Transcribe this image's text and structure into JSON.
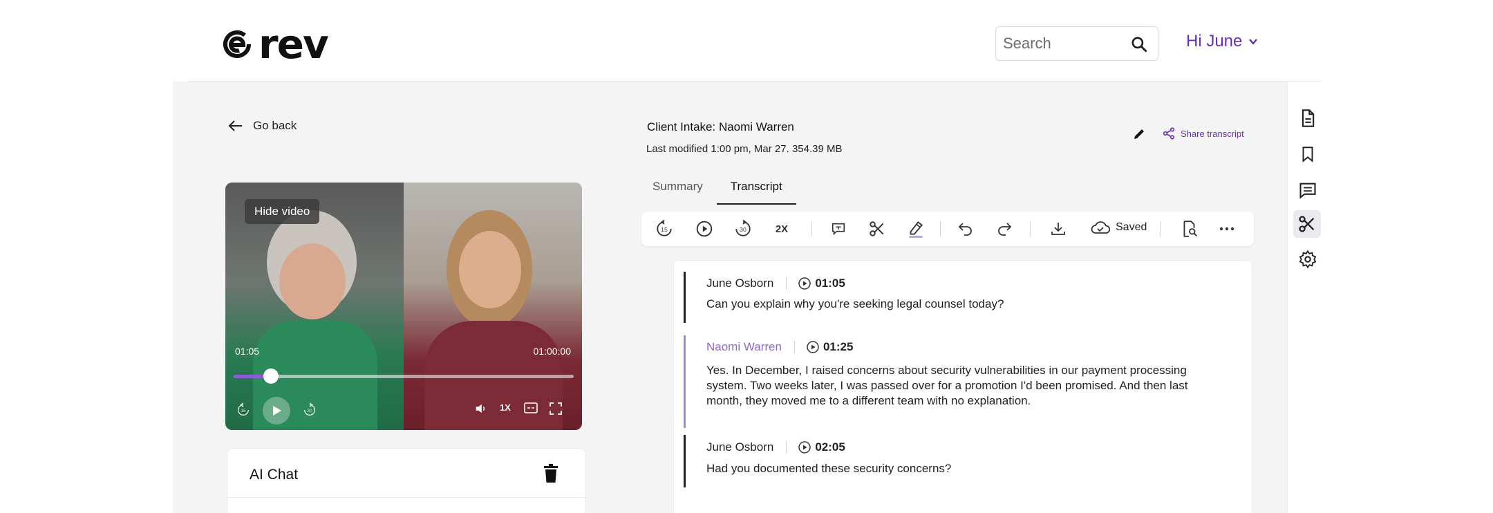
{
  "brand": {
    "logo_text": "rev",
    "accent": "#6a2fb5"
  },
  "header": {
    "search_placeholder": "Search",
    "greeting": "Hi June"
  },
  "nav": {
    "go_back": "Go back"
  },
  "document": {
    "title": "Client Intake: Naomi Warren",
    "meta": "Last modified 1:00 pm, Mar 27. 354.39 MB",
    "share_label": "Share transcript"
  },
  "tabs": [
    {
      "label": "Summary",
      "active": false
    },
    {
      "label": "Transcript",
      "active": true
    }
  ],
  "toolbar": {
    "speed_label": "2X",
    "saved_label": "Saved"
  },
  "video": {
    "hide_label": "Hide video",
    "current_time": "01:05",
    "total_time": "01:00:00",
    "progress": 0.11,
    "speed_label": "1X",
    "skip_back_label": "15",
    "skip_forward_label": "30"
  },
  "ai_chat": {
    "title": "AI Chat"
  },
  "transcript": [
    {
      "speaker": "June Osborn",
      "time": "01:05",
      "active": false,
      "text": "Can you explain why you're seeking legal counsel today?"
    },
    {
      "speaker": "Naomi Warren",
      "time": "01:25",
      "active": true,
      "text": "Yes. In December, I raised concerns about security vulnerabilities in our payment processing system. Two weeks later, I was passed over for a promotion I'd been promised. And then last month, they moved me to a different team with no explanation."
    },
    {
      "speaker": "June Osborn",
      "time": "02:05",
      "active": false,
      "text": "Had you documented these security concerns?"
    }
  ]
}
